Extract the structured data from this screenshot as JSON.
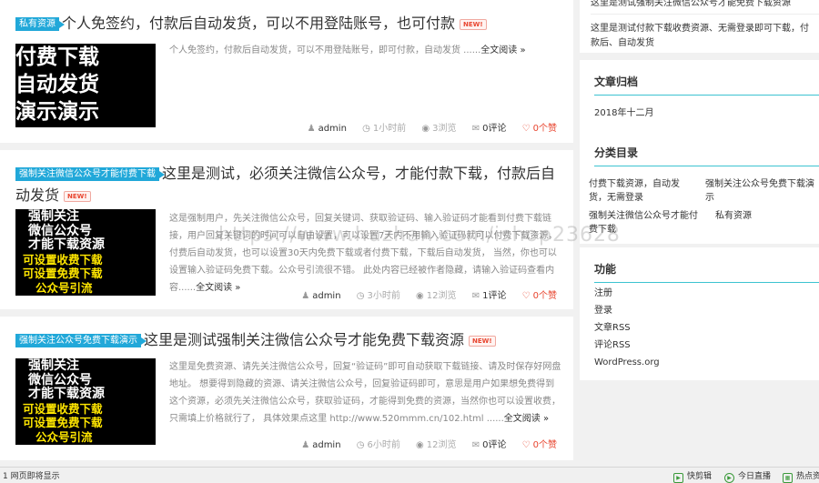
{
  "posts": [
    {
      "category": "私有资源",
      "title": "个人免签约，付款后自动发货，可以不用登陆账号，也可付款",
      "new_badge": "NEW!",
      "thumb_lines": [
        "付费下载",
        "自动发货",
        "演示演示"
      ],
      "excerpt": "个人免签约，付款后自动发货，可以不用登陆账号，即可付款，自动发货 ......",
      "more": "全文阅读 »",
      "author": "admin",
      "time": "1小时前",
      "views": "3浏览",
      "comments": "0评论",
      "likes": "0个赞"
    },
    {
      "category": "强制关注微信公众号才能付费下载",
      "title": "这里是测试，必须关注微信公众号，才能付款下载，付款后自动发货",
      "new_badge": "NEW!",
      "thumb_lines": [
        "强制关注",
        "微信公众号",
        "才能下载资源",
        "可设置收费下载",
        "可设置免费下载",
        "公众号引流"
      ],
      "excerpt": "这是强制用户，先关注微信公众号，回复关键词、获取验证码、输入验证码才能看到付费下载链接，用户回复关键词的时间可以自由设置，可以设置7天内不用输入验证码就可以付费下载资源，付费后自动发货，也可以设置30天内免费下载或者付费下载，下载后自动发货， 当然，你也可以设置输入验证码免费下载。公众号引流很不错。 此处内容已经被作者隐藏，请输入验证码查看内容......",
      "more": "全文阅读 »",
      "author": "admin",
      "time": "3小时前",
      "views": "12浏览",
      "comments": "1评论",
      "likes": "0个赞"
    },
    {
      "category": "强制关注公众号免费下载演示",
      "title": "这里是测试强制关注微信公众号才能免费下载资源",
      "new_badge": "NEW!",
      "thumb_lines": [
        "强制关注",
        "微信公众号",
        "才能下载资源",
        "可设置收费下载",
        "可设置免费下载",
        "公众号引流"
      ],
      "excerpt": "这里是免费资源、请先关注微信公众号，回复“验证码”即可自动获取下载链接、请及时保存好网盘地址。 想要得到隐藏的资源、请关注微信公众号，回复验证码即可，意思是用户如果想免费得到这个资源，必须先关注微信公众号，获取验证码，才能得到免费的资源，当然你也可以设置收费， 只需填上价格就行了， 具体效果点这里 http://www.520mmm.cn/102.html ......",
      "more": "全文阅读 »",
      "author": "admin",
      "time": "6小时前",
      "views": "12浏览",
      "comments": "0评论",
      "likes": "0个赞"
    }
  ],
  "sidebar": {
    "recent": [
      "这里是测试强制关注微信公众号才能免费下载资源",
      "这里是测试付款下载收费资源、无需登录即可下载，付款后、自动发货"
    ],
    "archive": {
      "title": "文章归档",
      "items": [
        "2018年十二月"
      ]
    },
    "categories": {
      "title": "分类目录",
      "items": [
        "付费下载资源，自动发货，无需登录",
        "强制关注公众号免费下载演示",
        "强制关注微信公众号才能付费下载",
        "私有资源"
      ]
    },
    "functions": {
      "title": "功能",
      "items": [
        "注册",
        "登录",
        "文章RSS",
        "评论RSS",
        "WordPress.org"
      ]
    }
  },
  "watermark": "https://www.huzhan.com/ishop23628",
  "statusbar": {
    "left": "1 网页即将显示",
    "items": [
      "快剪辑",
      "今日直播",
      "热点资讯"
    ]
  }
}
